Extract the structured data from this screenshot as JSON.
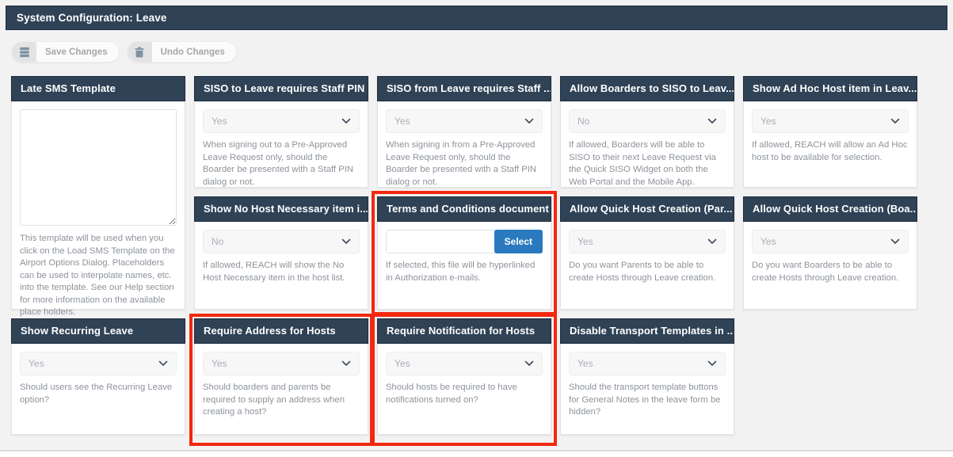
{
  "title_bar": {
    "title": "System Configuration: Leave"
  },
  "toolbar": {
    "save_button": "Save Changes",
    "undo_button": "Undo Changes"
  },
  "colors": {
    "header_navy": "#2f4256",
    "highlight_red": "#f3280f",
    "select_button_blue": "#2b7abf",
    "page_background": "#f2f2f3"
  },
  "cards": [
    {
      "title": "Late SMS Template",
      "control": "textarea",
      "value": "",
      "description": "This template will be used when you click on the Load SMS Template on the Airport Options Dialog. Placeholders can be used to interpolate names, etc. into the template. See our Help section for more information on the available place holders."
    },
    {
      "title": "SISO to Leave requires Staff PIN",
      "control": "select",
      "value": "Yes",
      "description": "When signing out to a Pre-Approved Leave Request only, should the Boarder be presented with a Staff PIN dialog or not."
    },
    {
      "title": "SISO from Leave requires Staff ...",
      "control": "select",
      "value": "Yes",
      "description": "When signing in from a Pre-Approved Leave Request only, should the Boarder be presented with a Staff PIN dialog or not."
    },
    {
      "title": "Allow Boarders to SISO to Leav...",
      "control": "select",
      "value": "No",
      "description": "If allowed, Boarders will be able to SISO to their next Leave Request via the Quick SISO Widget on both the Web Portal and the Mobile App."
    },
    {
      "title": "Show Ad Hoc Host item in Leav...",
      "control": "select",
      "value": "Yes",
      "description": "If allowed, REACH will allow an Ad Hoc host to be available for selection."
    },
    {
      "title": "Show No Host Necessary item i...",
      "control": "select",
      "value": "No",
      "description": "If allowed, REACH will show the No Host Necessary item in the host list."
    },
    {
      "title": "Terms and Conditions document",
      "control": "file",
      "value": "",
      "button_label": "Select",
      "description": "If selected, this file will be hyperlinked in Authorization e-mails.",
      "highlighted": true
    },
    {
      "title": "Allow Quick Host Creation (Par...",
      "control": "select",
      "value": "Yes",
      "description": "Do you want Parents to be able to create Hosts through Leave creation."
    },
    {
      "title": "Allow Quick Host Creation (Boa...",
      "control": "select",
      "value": "Yes",
      "description": "Do you want Boarders to be able to create Hosts through Leave creation."
    },
    {
      "title": "Show Recurring Leave",
      "control": "select",
      "value": "Yes",
      "description": "Should users see the Recurring Leave option?"
    },
    {
      "title": "Require Address for Hosts",
      "control": "select",
      "value": "Yes",
      "description": "Should boarders and parents be required to supply an address when creating a host?",
      "highlighted": true
    },
    {
      "title": "Require Notification for Hosts",
      "control": "select",
      "value": "Yes",
      "description": "Should hosts be required to have notifications turned on?",
      "highlighted": true
    },
    {
      "title": "Disable Transport Templates in ...",
      "control": "select",
      "value": "Yes",
      "description": "Should the transport template buttons for General Notes in the leave form be hidden?"
    }
  ]
}
